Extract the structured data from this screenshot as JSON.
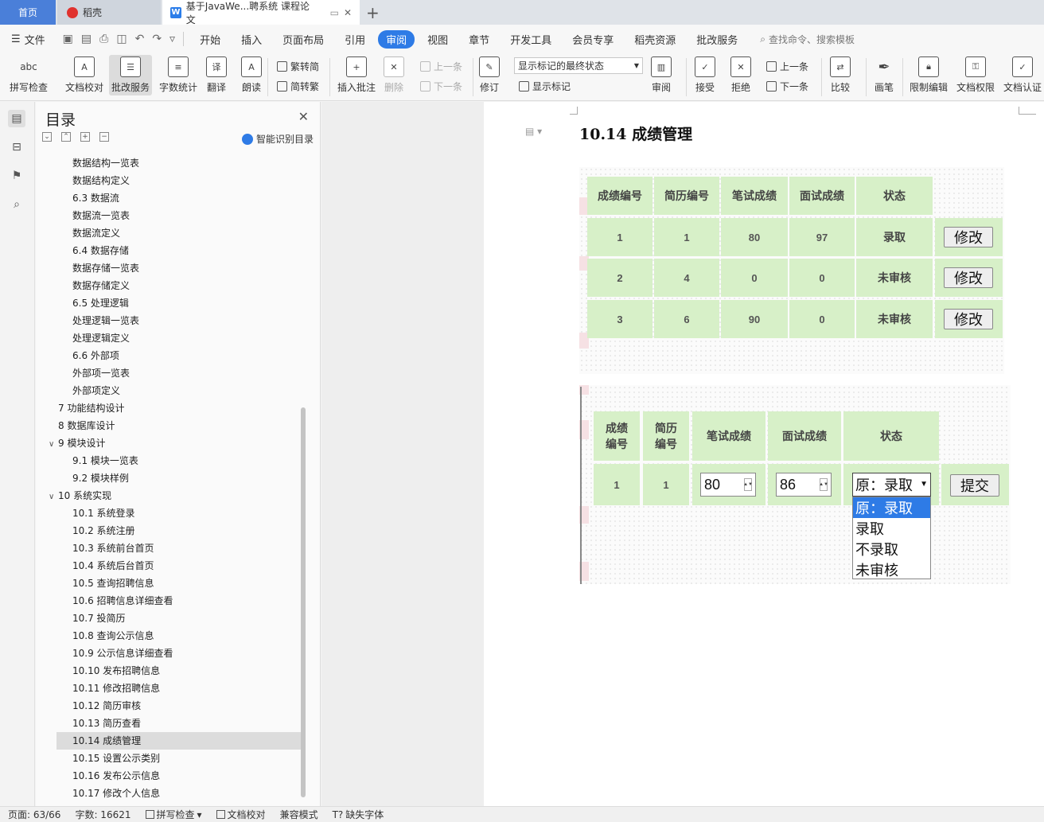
{
  "tabs": {
    "home": "首页",
    "docer": "稻壳",
    "doc_title": "基于JavaWe...聘系统 课程论文",
    "close": "✕",
    "new_tab": "+"
  },
  "menu": {
    "file": "文件",
    "items": [
      "开始",
      "插入",
      "页面布局",
      "引用",
      "审阅",
      "视图",
      "章节",
      "开发工具",
      "会员专享",
      "稻壳资源",
      "批改服务"
    ],
    "active": "审阅",
    "search": "查找命令、搜索模板"
  },
  "ribbon": {
    "spell_check": "拼写检查",
    "doc_check": "文档校对",
    "revise_service": "批改服务",
    "word_count": "字数统计",
    "translate": "翻译",
    "read_aloud": "朗读",
    "trad_to_simp": "繁转简",
    "simp_to_trad": "简转繁",
    "insert_comment": "插入批注",
    "delete": "删除",
    "prev_comment": "上一条",
    "next_comment": "下一条",
    "track": "修订",
    "markup_state": "显示标记的最终状态",
    "show_markup": "显示标记",
    "review": "审阅",
    "accept": "接受",
    "reject": "拒绝",
    "prev_change": "上一条",
    "next_change": "下一条",
    "compare": "比较",
    "pen": "画笔",
    "restrict": "限制编辑",
    "permission": "文档权限",
    "certify": "文档认证"
  },
  "toc": {
    "title": "目录",
    "smart": "智能识别目录",
    "items": [
      {
        "label": "数据结构一览表",
        "level": 3
      },
      {
        "label": "数据结构定义",
        "level": 3
      },
      {
        "label": "6.3  数据流",
        "level": 2
      },
      {
        "label": "数据流一览表",
        "level": 3
      },
      {
        "label": "数据流定义",
        "level": 3
      },
      {
        "label": "6.4  数据存储",
        "level": 2
      },
      {
        "label": "数据存储一览表",
        "level": 3
      },
      {
        "label": "数据存储定义",
        "level": 3
      },
      {
        "label": "6.5  处理逻辑",
        "level": 2
      },
      {
        "label": "处理逻辑一览表",
        "level": 3
      },
      {
        "label": "处理逻辑定义",
        "level": 3
      },
      {
        "label": "6.6  外部项",
        "level": 2
      },
      {
        "label": "外部项一览表",
        "level": 3
      },
      {
        "label": "外部项定义",
        "level": 3
      },
      {
        "label": "7    功能结构设计",
        "level": 1
      },
      {
        "label": "8    数据库设计",
        "level": 1
      },
      {
        "label": "9    模块设计",
        "level": 1,
        "expanded": true
      },
      {
        "label": "9.1  模块一览表",
        "level": 2
      },
      {
        "label": "9.2  模块样例",
        "level": 2
      },
      {
        "label": "10    系统实现",
        "level": 1,
        "expanded": true
      },
      {
        "label": "10.1  系统登录",
        "level": 2
      },
      {
        "label": "10.2  系统注册",
        "level": 2
      },
      {
        "label": "10.3  系统前台首页",
        "level": 2
      },
      {
        "label": "10.4 系统后台首页",
        "level": 2
      },
      {
        "label": "10.5  查询招聘信息",
        "level": 2
      },
      {
        "label": "10.6  招聘信息详细查看",
        "level": 2
      },
      {
        "label": "10.7  投简历",
        "level": 2
      },
      {
        "label": "10.8  查询公示信息",
        "level": 2
      },
      {
        "label": "10.9  公示信息详细查看",
        "level": 2
      },
      {
        "label": "10.10  发布招聘信息",
        "level": 2
      },
      {
        "label": "10.11  修改招聘信息",
        "level": 2
      },
      {
        "label": "10.12  简历审核",
        "level": 2
      },
      {
        "label": "10.13    简历查看",
        "level": 2
      },
      {
        "label": "10.14  成绩管理",
        "level": 2,
        "selected": true
      },
      {
        "label": "10.15  设置公示类别",
        "level": 2
      },
      {
        "label": "10.16 发布公示信息",
        "level": 2
      },
      {
        "label": "10.17  修改个人信息",
        "level": 2
      }
    ]
  },
  "document": {
    "heading": "10.14  成绩管理",
    "table1": {
      "headers": [
        "成绩编号",
        "简历编号",
        "笔试成绩",
        "面试成绩",
        "状态"
      ],
      "rows": [
        [
          "1",
          "1",
          "80",
          "97",
          "录取"
        ],
        [
          "2",
          "4",
          "0",
          "0",
          "未审核"
        ],
        [
          "3",
          "6",
          "90",
          "0",
          "未审核"
        ]
      ],
      "action": "修改"
    },
    "table2": {
      "headers": [
        "成绩编号",
        "简历编号",
        "笔试成绩",
        "面试成绩",
        "状态"
      ],
      "row": {
        "score_id": "1",
        "resume_id": "1",
        "written": "80",
        "interview": "86"
      },
      "status_selected": "原：录取",
      "status_options": [
        "原：录取",
        "录取",
        "不录取",
        "未审核"
      ],
      "submit": "提交"
    }
  },
  "status_bar": {
    "page": "页面: 63/66",
    "words": "字数: 16621",
    "spell": "拼写检查",
    "proof": "文档校对",
    "compat": "兼容模式",
    "missing_font": "缺失字体"
  },
  "colors": {
    "accent": "#2e7be6",
    "cell_green": "#d7f0c8",
    "home_tab": "#4a7fd9"
  }
}
